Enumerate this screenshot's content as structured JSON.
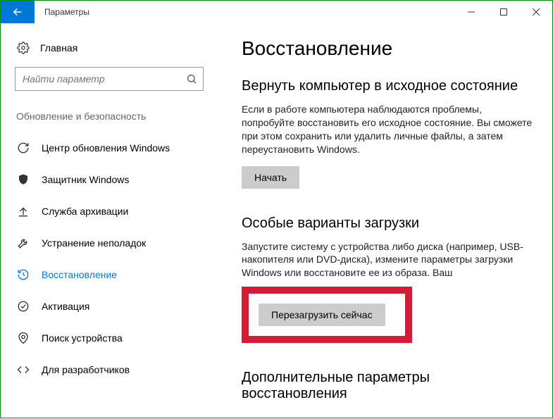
{
  "titlebar": {
    "title": "Параметры"
  },
  "sidebar": {
    "home_label": "Главная",
    "search_placeholder": "Найти параметр",
    "section_label": "Обновление и безопасность",
    "items": [
      {
        "label": "Центр обновления Windows"
      },
      {
        "label": "Защитник Windows"
      },
      {
        "label": "Служба архивации"
      },
      {
        "label": "Устранение неполадок"
      },
      {
        "label": "Восстановление"
      },
      {
        "label": "Активация"
      },
      {
        "label": "Поиск устройства"
      },
      {
        "label": "Для разработчиков"
      }
    ]
  },
  "main": {
    "heading": "Восстановление",
    "reset": {
      "title": "Вернуть компьютер в исходное состояние",
      "body": "Если в работе компьютера наблюдаются проблемы, попробуйте восстановить его исходное состояние. Вы сможете при этом сохранить или удалить личные файлы, а затем переустановить Windows.",
      "button": "Начать"
    },
    "advanced": {
      "title": "Особые варианты загрузки",
      "body": "Запустите систему с устройства либо диска (например, USB-накопителя или DVD-диска), измените параметры загрузки Windows или восстановите ее из образа. Ваш",
      "button": "Перезагрузить сейчас"
    },
    "more": {
      "title": "Дополнительные параметры восстановления"
    }
  }
}
